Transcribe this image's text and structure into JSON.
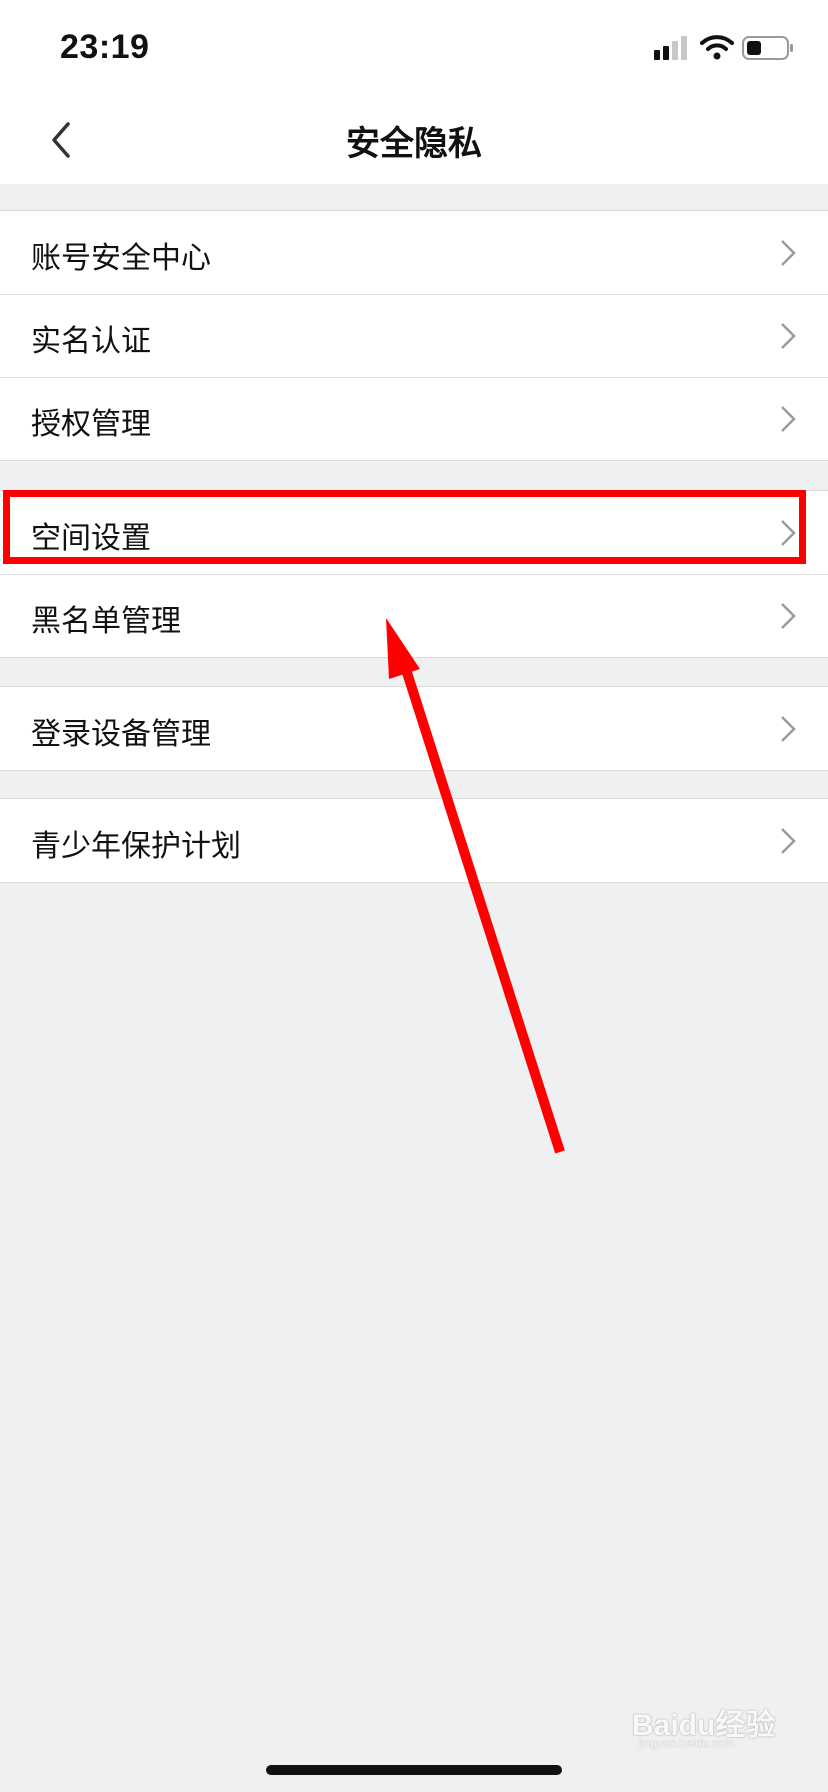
{
  "status_bar": {
    "time": "23:19"
  },
  "nav": {
    "title": "安全隐私"
  },
  "groups": [
    {
      "items": [
        {
          "label": "账号安全中心"
        },
        {
          "label": "实名认证"
        },
        {
          "label": "授权管理"
        }
      ]
    },
    {
      "items": [
        {
          "label": "空间设置"
        },
        {
          "label": "黑名单管理"
        }
      ]
    },
    {
      "items": [
        {
          "label": "登录设备管理"
        }
      ]
    },
    {
      "items": [
        {
          "label": "青少年保护计划"
        }
      ]
    }
  ],
  "annotation": {
    "highlight_color": "#ff0000",
    "highlighted_item": "空间设置"
  },
  "watermark": {
    "text": "Baidu经验",
    "sub": "jingyan.baidu.com"
  },
  "colors": {
    "background": "#eff0f2",
    "surface": "#ffffff",
    "text": "#111111",
    "chevron": "#9b9b9b"
  },
  "icons": [
    "back-icon",
    "signal-icon",
    "wifi-icon",
    "battery-icon",
    "chevron-right-icon"
  ]
}
